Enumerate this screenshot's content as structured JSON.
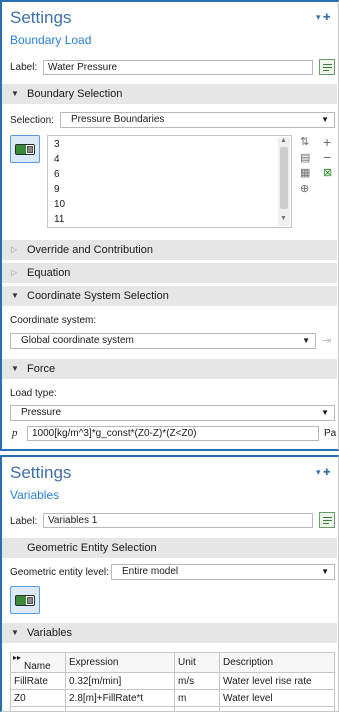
{
  "boundary_load": {
    "settings_title": "Settings",
    "subtitle": "Boundary Load",
    "label_caption": "Label:",
    "label_value": "Water Pressure",
    "sections": {
      "boundary_selection": "Boundary Selection",
      "override": "Override and Contribution",
      "equation": "Equation",
      "coordinate": "Coordinate System Selection",
      "force": "Force"
    },
    "selection_caption": "Selection:",
    "selection_value": "Pressure Boundaries",
    "boundaries": [
      "3",
      "4",
      "6",
      "9",
      "10",
      "11"
    ],
    "coord_caption": "Coordinate system:",
    "coord_value": "Global coordinate system",
    "load_type_caption": "Load type:",
    "load_type_value": "Pressure",
    "pressure_symbol": "p",
    "pressure_expr": "1000[kg/m^3]*g_const*(Z0-Z)*(Z<Z0)",
    "pressure_unit": "Pa"
  },
  "variables": {
    "settings_title": "Settings",
    "subtitle": "Variables",
    "label_caption": "Label:",
    "label_value": "Variables 1",
    "geom_section": "Geometric Entity Selection",
    "geom_level_caption": "Geometric entity level:",
    "geom_level_value": "Entire model",
    "variables_section": "Variables",
    "table": {
      "headers": [
        "Name",
        "Expression",
        "Unit",
        "Description"
      ],
      "rows": [
        [
          "FillRate",
          "0.32[m/min]",
          "m/s",
          "Water level rise rate"
        ],
        [
          "Z0",
          "2.8[m]+FillRate*t",
          "m",
          "Water level"
        ]
      ]
    }
  },
  "icons": {
    "pin": "pin-icon",
    "list_add": "plus-icon",
    "list_remove": "minus-icon",
    "paste": "paste-icon",
    "copy": "copy-icon",
    "zoom": "zoom-selected-icon",
    "clear": "clear-selection-icon",
    "create_selection": "create-selection-icon",
    "move_up": "move-up-icon",
    "move_down": "move-down-icon"
  },
  "colors": {
    "accent": "#2a6db5",
    "title": "#3c6fa6",
    "section_bg": "#e6e6e6",
    "toggle_active": "#3a8a3a"
  }
}
